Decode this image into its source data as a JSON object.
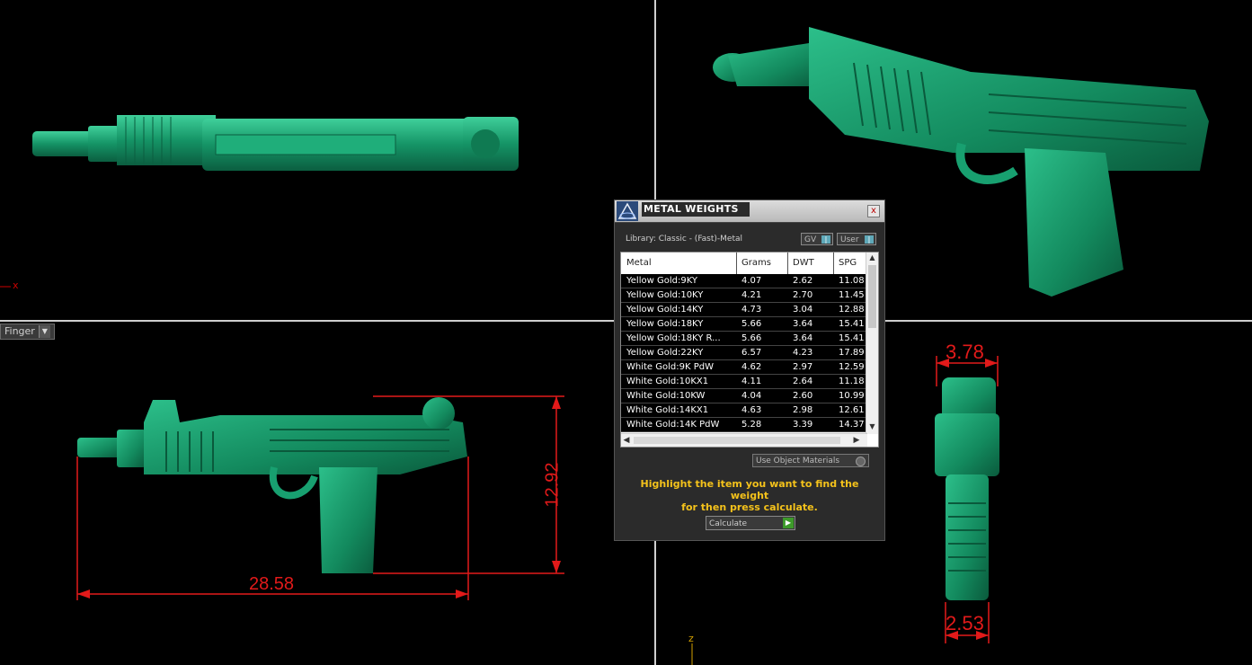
{
  "viewport": {
    "view_label": "Finger",
    "axis_x_label": "x",
    "axis_z_label": "z"
  },
  "dimensions": {
    "length": "28.58",
    "height": "12.92",
    "top_width": "3.78",
    "bottom_width": "2.53"
  },
  "dialog": {
    "title": "METAL WEIGHTS",
    "close_label": "x",
    "library": "Library: Classic - (Fast)-Metal",
    "toggle_gv": "GV",
    "toggle_user": "User",
    "columns": [
      "Metal",
      "Grams",
      "DWT",
      "SPG"
    ],
    "rows": [
      [
        "Yellow Gold:9KY",
        "4.07",
        "2.62",
        "11.08"
      ],
      [
        "Yellow Gold:10KY",
        "4.21",
        "2.70",
        "11.45"
      ],
      [
        "Yellow Gold:14KY",
        "4.73",
        "3.04",
        "12.88"
      ],
      [
        "Yellow Gold:18KY",
        "5.66",
        "3.64",
        "15.41"
      ],
      [
        "Yellow Gold:18KY R...",
        "5.66",
        "3.64",
        "15.41"
      ],
      [
        "Yellow Gold:22KY",
        "6.57",
        "4.23",
        "17.89"
      ],
      [
        "White Gold:9K PdW",
        "4.62",
        "2.97",
        "12.59"
      ],
      [
        "White Gold:10KX1",
        "4.11",
        "2.64",
        "11.18"
      ],
      [
        "White Gold:10KW",
        "4.04",
        "2.60",
        "10.99"
      ],
      [
        "White Gold:14KX1",
        "4.63",
        "2.98",
        "12.61"
      ],
      [
        "White Gold:14K PdW",
        "5.28",
        "3.39",
        "14.37"
      ]
    ],
    "use_object_materials": "Use Object Materials",
    "hint_line1": "Highlight the item you want to find the weight",
    "hint_line2": "for then press calculate.",
    "calculate_label": "Calculate",
    "colors": {
      "model": "#1a9a6c",
      "dimension": "#e21a1a",
      "hint": "#f4c21b"
    }
  }
}
